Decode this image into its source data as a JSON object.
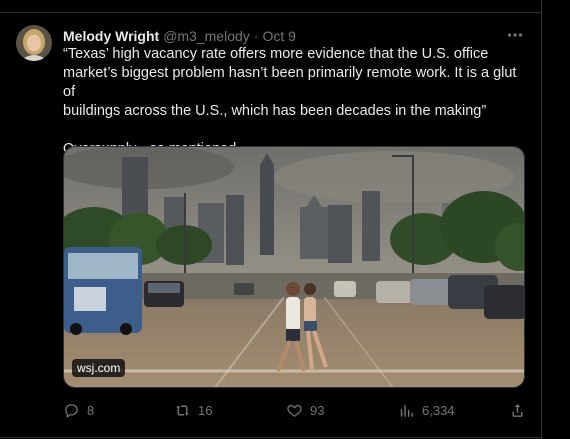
{
  "tweet": {
    "author_name": "Melody Wright",
    "handle": "@m3_melody",
    "separator": "·",
    "time": "Oct 9",
    "text_lines": [
      "“Texas’ high vacancy rate offers more evidence that the U.S. office",
      "market’s biggest problem hasn’t been primarily remote work. It is a glut of",
      "buildings across the U.S., which has been decades in the making”"
    ],
    "text_followup": "Oversupply - as mentioned",
    "media_source": "wsj.com",
    "more_label": "•••"
  },
  "actions": {
    "replies": "8",
    "reposts": "16",
    "likes": "93",
    "views": "6,334"
  },
  "icons": {
    "reply": "reply-icon",
    "repost": "repost-icon",
    "like": "heart-icon",
    "views": "views-icon",
    "share": "share-icon",
    "more": "more-icon"
  },
  "colors": {
    "background": "#000000",
    "text": "#e7e9ea",
    "muted": "#71767b",
    "border": "#2f3336"
  }
}
